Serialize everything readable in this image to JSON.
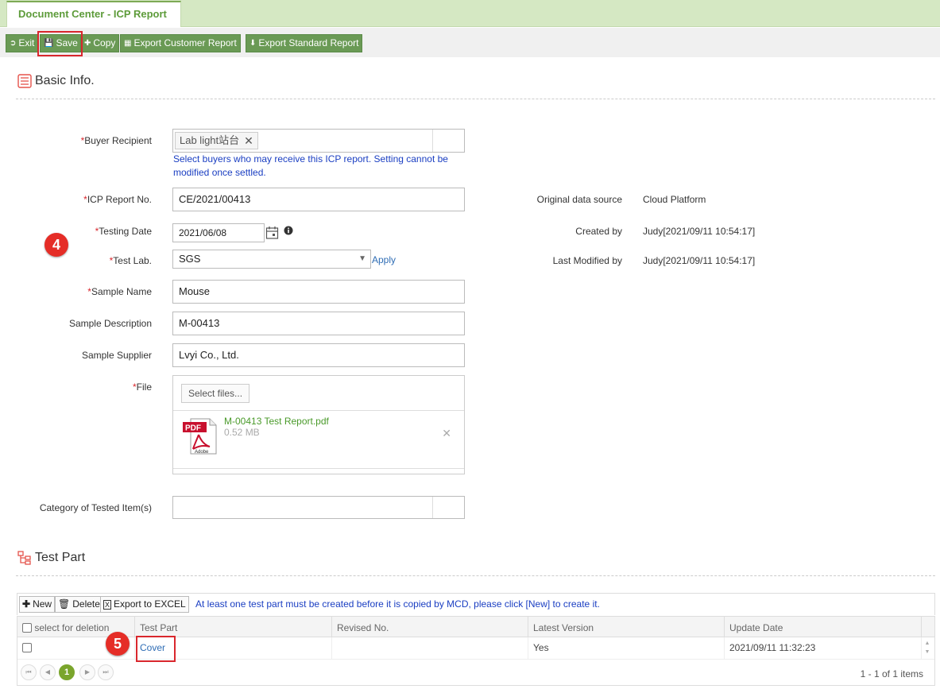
{
  "tab": {
    "title": "Document Center - ICP Report"
  },
  "toolbar": {
    "exit": "Exit",
    "save": "Save",
    "copy": "Copy",
    "export_customer": "Export Customer Report",
    "export_standard": "Export Standard Report"
  },
  "basic_info": {
    "title": "Basic Info.",
    "buyer_recipient": {
      "label": "Buyer Recipient",
      "chip": "Lab light站台",
      "hint": "Select buyers who may receive this ICP report. Setting cannot be modified once settled."
    },
    "icp_report_no": {
      "label": "ICP Report No.",
      "value": "CE/2021/00413"
    },
    "testing_date": {
      "label": "Testing Date",
      "value": "2021/06/08"
    },
    "test_lab": {
      "label": "Test Lab.",
      "value": "SGS",
      "apply": "Apply"
    },
    "sample_name": {
      "label": "Sample Name",
      "value": "Mouse"
    },
    "sample_description": {
      "label": "Sample Description",
      "value": "M-00413"
    },
    "sample_supplier": {
      "label": "Sample Supplier",
      "value": "Lvyi Co., Ltd."
    },
    "file": {
      "label": "File",
      "select": "Select files...",
      "name": "M-00413 Test Report.pdf",
      "size": "0.52 MB"
    },
    "category": {
      "label": "Category of Tested Item(s)"
    },
    "original_source": {
      "label": "Original data source",
      "value": "Cloud Platform"
    },
    "created_by": {
      "label": "Created by",
      "value": "Judy[2021/09/11 10:54:17]"
    },
    "last_modified_by": {
      "label": "Last Modified by",
      "value": "Judy[2021/09/11 10:54:17]"
    },
    "required_mark": "*"
  },
  "test_part": {
    "title": "Test Part",
    "toolbar": {
      "new": "New",
      "delete": "Delete",
      "export": "Export to EXCEL",
      "message": "At least one test part must be created before it is copied by MCD, please click [New] to create it."
    },
    "columns": [
      "select for deletion",
      "Test Part",
      "Revised No.",
      "Latest Version",
      "Update Date"
    ],
    "rows": [
      {
        "test_part": "Cover",
        "revised_no": "",
        "latest_version": "Yes",
        "update_date": "2021/09/11 11:32:23"
      }
    ],
    "pager": {
      "current_page": "1",
      "info": "1 - 1 of 1 items"
    }
  },
  "step_badges": {
    "first": "4",
    "second": "5"
  },
  "colors": {
    "accent_green": "#6a9a55",
    "highlight_red": "#d9272d",
    "link_blue": "#1a3ec2"
  }
}
